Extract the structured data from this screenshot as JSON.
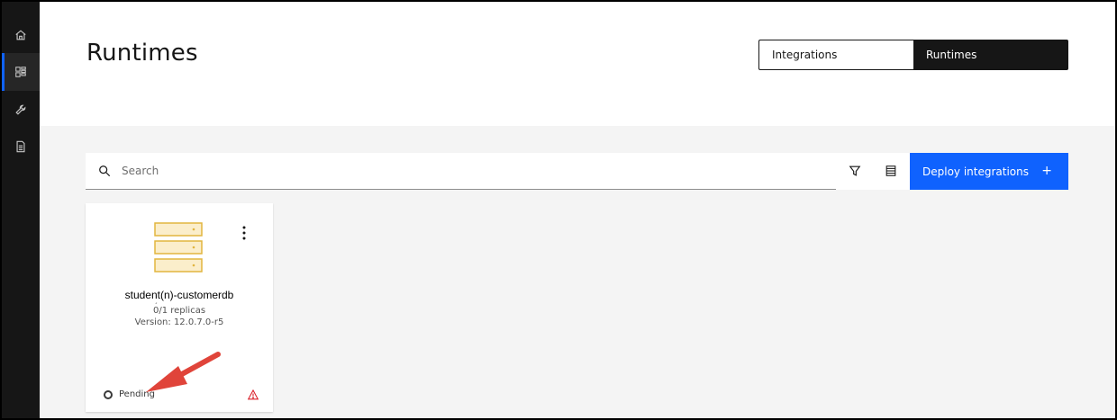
{
  "rail": {
    "items": [
      {
        "icon": "home-icon"
      },
      {
        "icon": "dashboard-icon",
        "active": true
      },
      {
        "icon": "wrench-icon"
      },
      {
        "icon": "document-icon"
      }
    ]
  },
  "header": {
    "title": "Runtimes",
    "switcher": {
      "integrations_label": "Integrations",
      "runtimes_label": "Runtimes"
    }
  },
  "toolbar": {
    "search_placeholder": "Search",
    "deploy_label": "Deploy integrations",
    "deploy_plus": "+"
  },
  "card": {
    "name": "student(n)-customerdb",
    "tick": "´",
    "replicas": "0/1 replicas",
    "version": "Version: 12.0.7.0-r5",
    "status": "Pending",
    "icon_color": "#f1c21b"
  },
  "colors": {
    "accent": "#0f62fe",
    "rail": "#161616",
    "annotation_arrow": "#e0443a",
    "warning": "#da1e28"
  }
}
